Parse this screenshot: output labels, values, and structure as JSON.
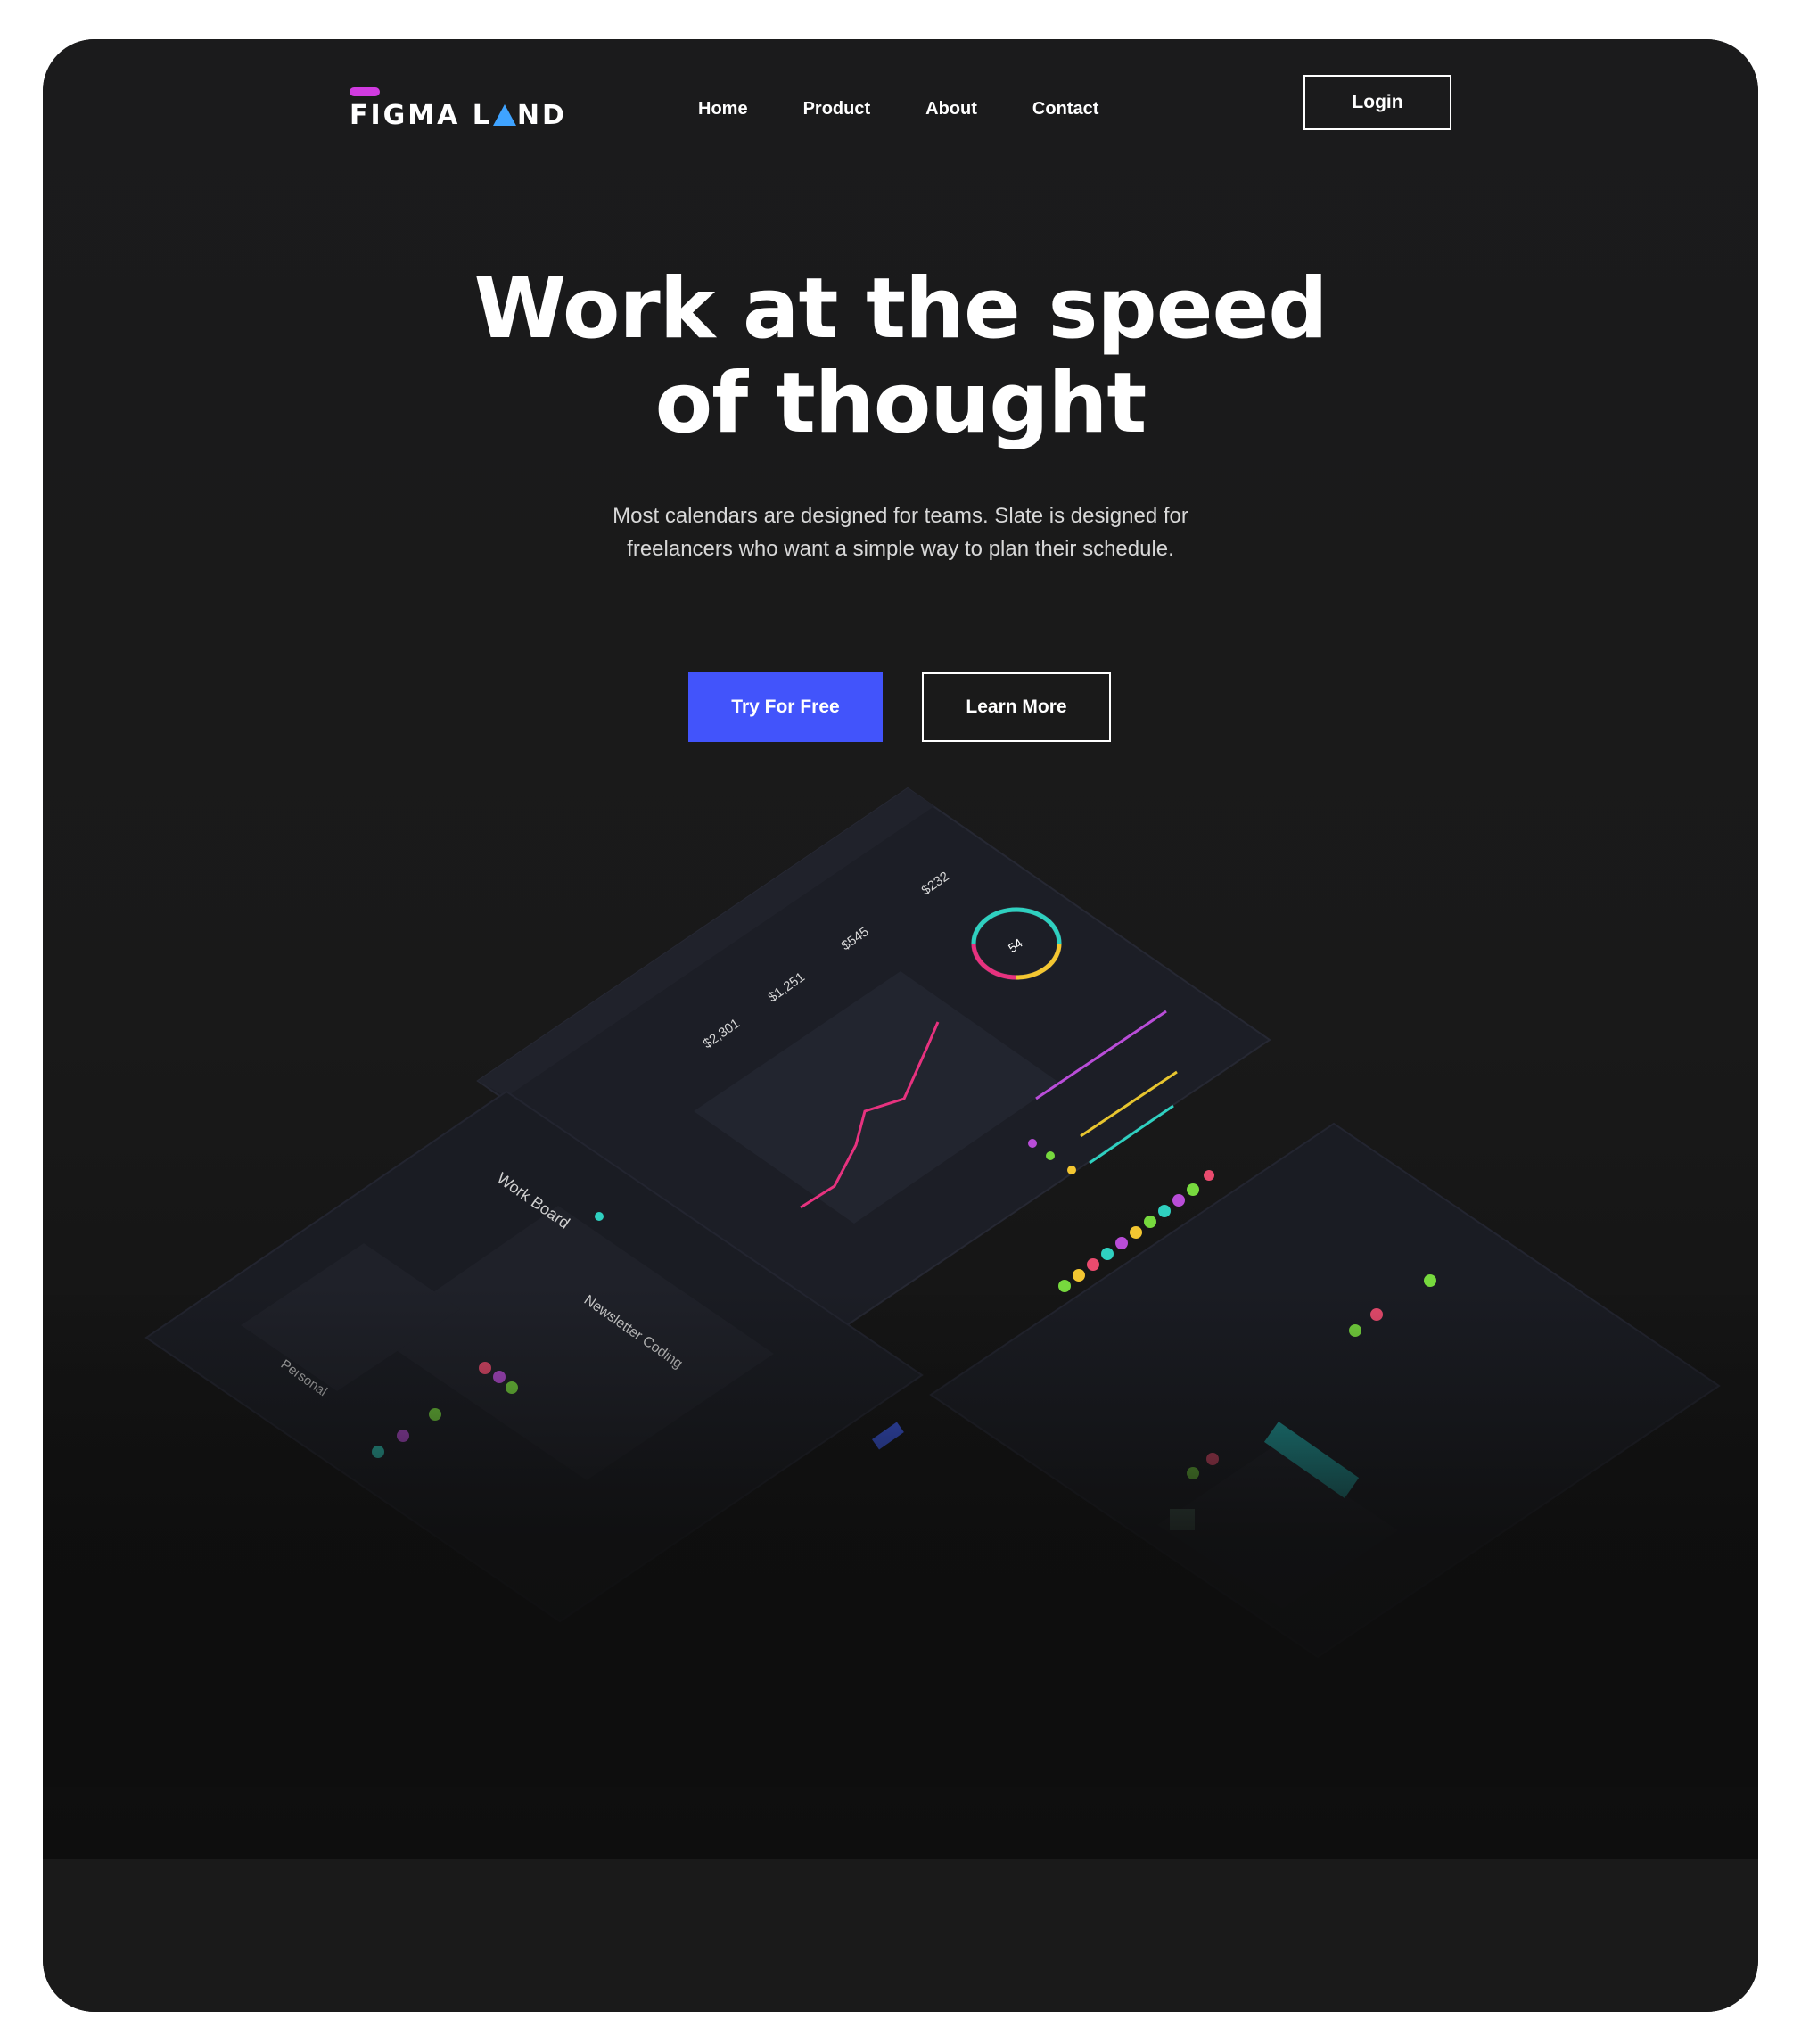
{
  "header": {
    "logo_text": "FIGMA LAND",
    "logo_part1": "FIGMA L",
    "logo_part2": "ND",
    "nav": [
      {
        "label": "Home"
      },
      {
        "label": "Product"
      },
      {
        "label": "About"
      },
      {
        "label": "Contact"
      }
    ],
    "login_label": "Login"
  },
  "hero": {
    "headline_line1": "Work at the speed",
    "headline_line2": "of thought",
    "subtext_line1": "Most calendars are designed for teams. Slate is designed for",
    "subtext_line2": "freelancers who want a simple way to plan their schedule.",
    "primary_cta": "Try For Free",
    "secondary_cta": "Learn More"
  },
  "mockup": {
    "dashboard": {
      "stat_1": "$2,301",
      "stat_2": "$1,251",
      "stat_3": "$545",
      "stat_4": "$232",
      "ring_value": "54"
    },
    "board_title": "Work Board",
    "board_card": "Newsletter Coding",
    "board_column": "Personal"
  },
  "colors": {
    "accent": "#4254fb",
    "logo_bar": "#d13be0",
    "logo_triangle": "#3fa3ff",
    "background": "#181818"
  }
}
